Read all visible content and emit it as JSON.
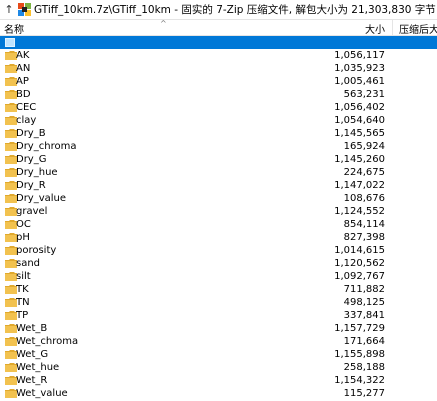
{
  "path_bar": {
    "up_icon": "up-arrow-icon",
    "archive_icon": "7zip-archive-icon",
    "text": "GTiff_10km.7z\\GTiff_10km - 固实的 7-Zip 压缩文件, 解包大小为 21,303,830 字节"
  },
  "columns": {
    "name": "名称",
    "size": "大小",
    "packed": "压缩后大小"
  },
  "rows": [
    {
      "name": "",
      "size": "",
      "selected": true
    },
    {
      "name": "AK",
      "size": "1,056,117"
    },
    {
      "name": "AN",
      "size": "1,035,923"
    },
    {
      "name": "AP",
      "size": "1,005,461"
    },
    {
      "name": "BD",
      "size": "563,231"
    },
    {
      "name": "CEC",
      "size": "1,056,402"
    },
    {
      "name": "clay",
      "size": "1,054,640"
    },
    {
      "name": "Dry_B",
      "size": "1,145,565"
    },
    {
      "name": "Dry_chroma",
      "size": "165,924"
    },
    {
      "name": "Dry_G",
      "size": "1,145,260"
    },
    {
      "name": "Dry_hue",
      "size": "224,675"
    },
    {
      "name": "Dry_R",
      "size": "1,147,022"
    },
    {
      "name": "Dry_value",
      "size": "108,676"
    },
    {
      "name": "gravel",
      "size": "1,124,552"
    },
    {
      "name": "OC",
      "size": "854,114"
    },
    {
      "name": "pH",
      "size": "827,398"
    },
    {
      "name": "porosity",
      "size": "1,014,615"
    },
    {
      "name": "sand",
      "size": "1,120,562"
    },
    {
      "name": "silt",
      "size": "1,092,767"
    },
    {
      "name": "TK",
      "size": "711,882"
    },
    {
      "name": "TN",
      "size": "498,125"
    },
    {
      "name": "TP",
      "size": "337,841"
    },
    {
      "name": "Wet_B",
      "size": "1,157,729"
    },
    {
      "name": "Wet_chroma",
      "size": "171,664"
    },
    {
      "name": "Wet_G",
      "size": "1,155,898"
    },
    {
      "name": "Wet_hue",
      "size": "258,188"
    },
    {
      "name": "Wet_R",
      "size": "1,154,322"
    },
    {
      "name": "Wet_value",
      "size": "115,277"
    }
  ],
  "colors": {
    "selection": "#0078d7",
    "folder": "#f2c24f"
  }
}
